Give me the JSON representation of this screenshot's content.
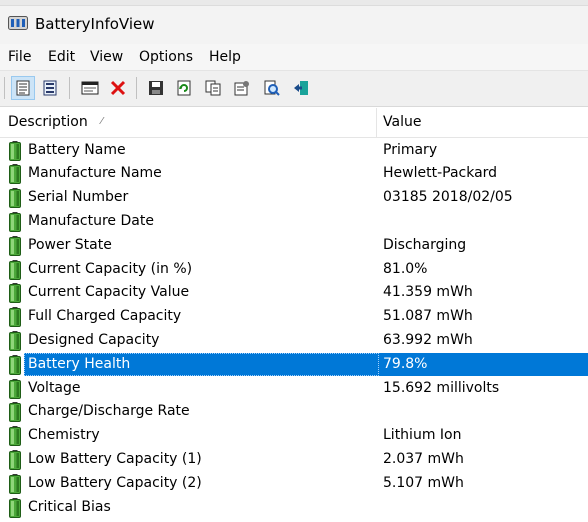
{
  "window": {
    "title": "BatteryInfoView"
  },
  "menu": {
    "items": [
      "File",
      "Edit",
      "View",
      "Options",
      "Help"
    ]
  },
  "toolbar": {
    "buttons": [
      {
        "name": "general-info-icon"
      },
      {
        "name": "log-view-icon"
      },
      {
        "name": "monitor-window-icon"
      },
      {
        "name": "delete-icon"
      },
      {
        "name": "save-icon"
      },
      {
        "name": "refresh-icon"
      },
      {
        "name": "copy-icon"
      },
      {
        "name": "properties-icon"
      },
      {
        "name": "find-icon"
      },
      {
        "name": "exit-icon"
      }
    ]
  },
  "list": {
    "columns": {
      "description": "Description",
      "value": "Value"
    },
    "rows": [
      {
        "description": "Battery Name",
        "value": "Primary"
      },
      {
        "description": "Manufacture Name",
        "value": "Hewlett-Packard"
      },
      {
        "description": "Serial Number",
        "value": "03185 2018/02/05"
      },
      {
        "description": "Manufacture Date",
        "value": ""
      },
      {
        "description": "Power State",
        "value": "Discharging"
      },
      {
        "description": "Current Capacity (in %)",
        "value": "81.0%"
      },
      {
        "description": "Current Capacity Value",
        "value": "41.359 mWh"
      },
      {
        "description": "Full Charged Capacity",
        "value": "51.087 mWh"
      },
      {
        "description": "Designed Capacity",
        "value": "63.992 mWh"
      },
      {
        "description": "Battery Health",
        "value": "79.8%",
        "selected": true
      },
      {
        "description": "Voltage",
        "value": "15.692 millivolts"
      },
      {
        "description": "Charge/Discharge Rate",
        "value": ""
      },
      {
        "description": "Chemistry",
        "value": "Lithium Ion"
      },
      {
        "description": "Low Battery Capacity (1)",
        "value": "2.037 mWh"
      },
      {
        "description": "Low Battery Capacity (2)",
        "value": "5.107 mWh"
      },
      {
        "description": "Critical Bias",
        "value": ""
      }
    ]
  },
  "colors": {
    "selection": "#0078d7",
    "battery_green": "#3f9b2c"
  }
}
